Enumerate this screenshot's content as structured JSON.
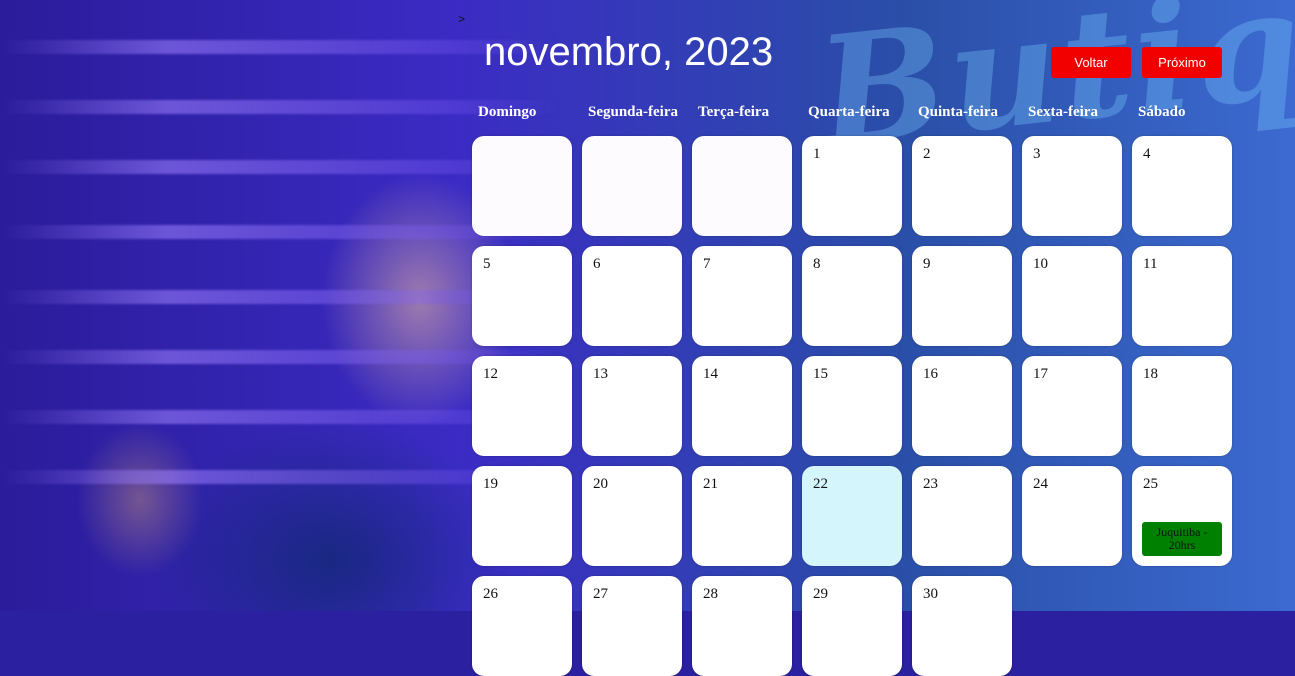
{
  "calendar": {
    "title": "novembro, 2023",
    "buttons": {
      "back": "Voltar",
      "next": "Próximo"
    },
    "weekdays": [
      "Domingo",
      "Segunda-feira",
      "Terça-feira",
      "Quarta-feira",
      "Quinta-feira",
      "Sexta-feira",
      "Sábado"
    ],
    "weeks": [
      [
        "",
        "",
        "",
        "1",
        "2",
        "3",
        "4"
      ],
      [
        "5",
        "6",
        "7",
        "8",
        "9",
        "10",
        "11"
      ],
      [
        "12",
        "13",
        "14",
        "15",
        "16",
        "17",
        "18"
      ],
      [
        "19",
        "20",
        "21",
        "22",
        "23",
        "24",
        "25"
      ],
      [
        "26",
        "27",
        "28",
        "29",
        "30",
        "",
        ""
      ]
    ],
    "highlighted_day": "22",
    "events": [
      {
        "day": "25",
        "label": "Juquitiba - 20hrs",
        "color": "#008000"
      }
    ]
  },
  "colors": {
    "button": "#f20000",
    "today": "#d5f5fd",
    "event": "#008000"
  },
  "marker": ">"
}
